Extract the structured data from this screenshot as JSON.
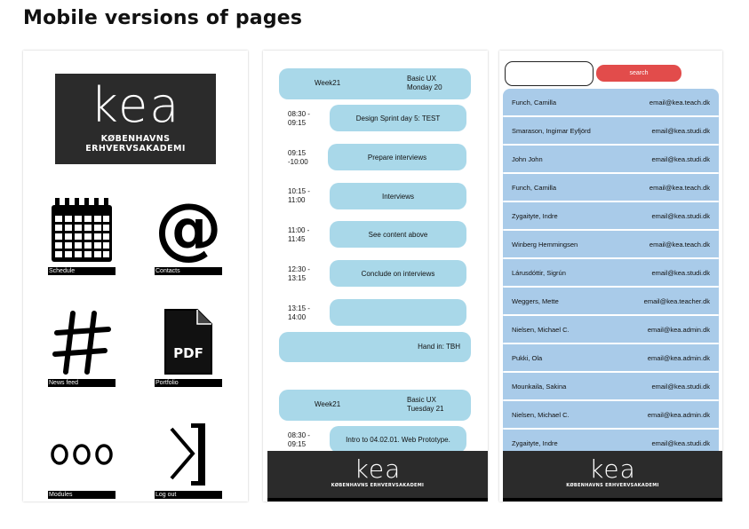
{
  "page": {
    "title": "Mobile versions of pages"
  },
  "logo": {
    "word": "kea",
    "subtitle": "KØBENHAVNS ERHVERVSAKADEMI"
  },
  "menu": {
    "tiles": [
      {
        "label": "Schedule",
        "icon": "calendar-icon"
      },
      {
        "label": "Contacts",
        "icon": "at-sign-icon"
      },
      {
        "label": "News feed",
        "icon": "hashtag-icon"
      },
      {
        "label": "Portfolio",
        "icon": "pdf-file-icon"
      },
      {
        "label": "Modules",
        "icon": "three-circles-icon"
      },
      {
        "label": "Log out",
        "icon": "logout-icon"
      }
    ]
  },
  "schedule": {
    "day1": {
      "week": "Week21",
      "course": "Basic UX",
      "day": "Monday 20"
    },
    "sessions": [
      {
        "time": "08:30 -\n09:15",
        "title": "Design Sprint day 5: TEST"
      },
      {
        "time": "09:15\n-10:00",
        "title": "Prepare interviews"
      },
      {
        "time": "10:15 -\n11:00",
        "title": "Interviews"
      },
      {
        "time": "11:00 -\n11:45",
        "title": "See content above"
      },
      {
        "time": "12:30 -\n13:15",
        "title": "Conclude on interviews"
      },
      {
        "time": "13:15 -\n14:00",
        "title": ""
      }
    ],
    "hand_in": "Hand in: TBH",
    "day2": {
      "week": "Week21",
      "course": "Basic UX",
      "day": "Tuesday 21"
    },
    "day2_session": {
      "time": "08:30 -\n09:15",
      "title": "Intro to 04.02.01. Web Prototype."
    }
  },
  "contacts": {
    "search_value": "",
    "search_button": "search",
    "rows": [
      {
        "name": "Funch, Camilla",
        "email": "email@kea.teach.dk"
      },
      {
        "name": "Smarason, Ingimar Eyfjörd",
        "email": "email@kea.studi.dk"
      },
      {
        "name": "John John",
        "email": "email@kea.studi.dk"
      },
      {
        "name": "Funch, Camilla",
        "email": "email@kea.teach.dk"
      },
      {
        "name": "Zygaityte, Indre",
        "email": "email@kea.studi.dk"
      },
      {
        "name": "Winberg Hemmingsen",
        "email": "email@kea.teach.dk"
      },
      {
        "name": "Lárusdóttir, Sigrún",
        "email": "email@kea.studi.dk"
      },
      {
        "name": "Weggers, Mette",
        "email": "email@kea.teacher.dk"
      },
      {
        "name": "Nielsen, Michael C.",
        "email": "email@kea.admin.dk"
      },
      {
        "name": "Pukki, Ola",
        "email": "email@kea.admin.dk"
      },
      {
        "name": "Mounkaila, Sakina",
        "email": "email@kea.studi.dk"
      },
      {
        "name": "Nielsen, Michael C.",
        "email": "email@kea.admin.dk"
      },
      {
        "name": "Zygaityte, Indre",
        "email": "email@kea.studi.dk"
      }
    ]
  },
  "colors": {
    "block": "#a9d8e9",
    "list": "#a9cbe9",
    "search_button": "#e24c4b",
    "logo_bg": "#2b2b2b"
  }
}
